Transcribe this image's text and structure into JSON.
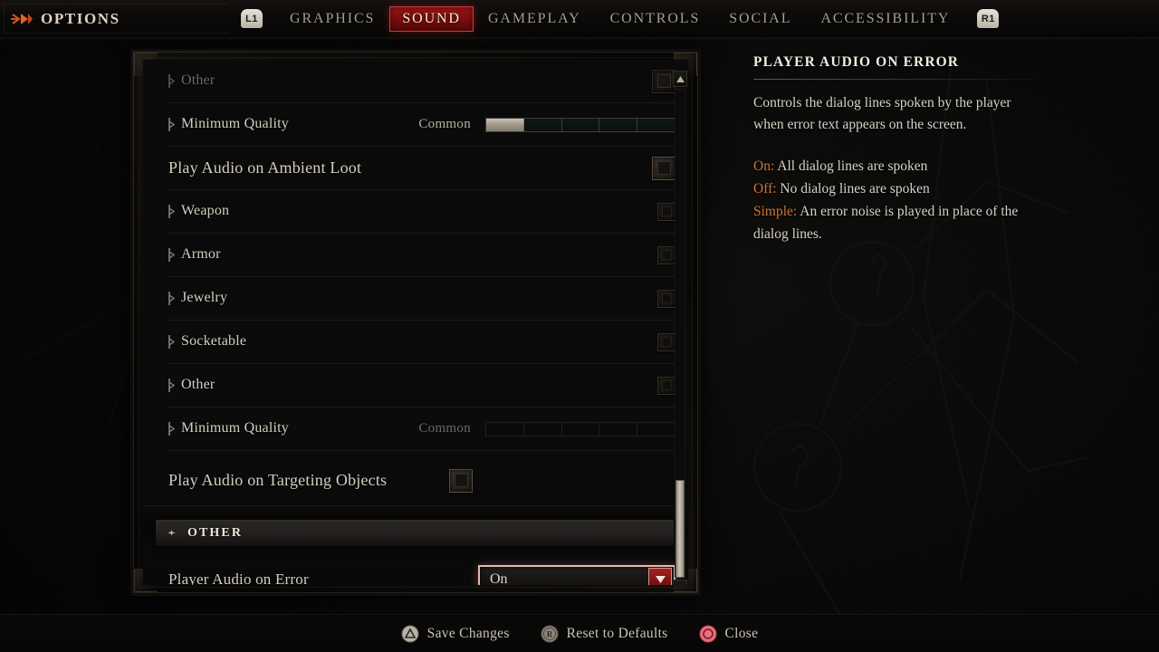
{
  "topbar": {
    "arrow_icon": "double-arrow-icon",
    "title": "OPTIONS",
    "left_bumper": "L1",
    "right_bumper": "R1",
    "tabs": [
      {
        "label": "GRAPHICS",
        "active": false
      },
      {
        "label": "SOUND",
        "active": true
      },
      {
        "label": "GAMEPLAY",
        "active": false
      },
      {
        "label": "CONTROLS",
        "active": false
      },
      {
        "label": "SOCIAL",
        "active": false
      },
      {
        "label": "ACCESSIBILITY",
        "active": false
      }
    ]
  },
  "settings_rows": [
    {
      "label": "Other",
      "type": "checkbox",
      "indent": true,
      "dim": true,
      "checked": false
    },
    {
      "label": "Minimum Quality",
      "type": "slider",
      "indent": true,
      "dim": false,
      "value": "Common",
      "segments": 5,
      "filled": 1
    },
    {
      "label": "Play Audio on Ambient Loot",
      "type": "checkbox",
      "indent": false,
      "dim": false,
      "checked": false
    },
    {
      "label": "Weapon",
      "type": "checkbox",
      "indent": true,
      "dim": false,
      "checked": false
    },
    {
      "label": "Armor",
      "type": "checkbox",
      "indent": true,
      "dim": false,
      "checked": false
    },
    {
      "label": "Jewelry",
      "type": "checkbox",
      "indent": true,
      "dim": false,
      "checked": false
    },
    {
      "label": "Socketable",
      "type": "checkbox",
      "indent": true,
      "dim": false,
      "checked": false
    },
    {
      "label": "Other",
      "type": "checkbox",
      "indent": true,
      "dim": false,
      "checked": false
    },
    {
      "label": "Minimum Quality",
      "type": "slider",
      "indent": true,
      "dim": true,
      "value": "Common",
      "segments": 5,
      "filled": 0
    },
    {
      "label": "Play Audio on Targeting Objects",
      "type": "checkbox",
      "indent": false,
      "dim": false,
      "checked": false
    }
  ],
  "other_section": {
    "ornament_icon": "diamond-ornament-icon",
    "title": "OTHER",
    "row": {
      "label": "Player Audio on Error",
      "dropdown_value": "On",
      "dropdown_arrow_icon": "chevron-down-icon"
    }
  },
  "scrollbar": {
    "up_icon": "arrow-up-icon",
    "down_icon": "arrow-down-icon"
  },
  "info_panel": {
    "title": "PLAYER AUDIO ON ERROR",
    "description": "Controls the dialog lines spoken by the player when error text appears on the screen.",
    "options": [
      {
        "key": "On:",
        "text": "All dialog lines are spoken"
      },
      {
        "key": "Off:",
        "text": "No dialog lines are spoken"
      },
      {
        "key": "Simple:",
        "text": "An error noise is played in place of the dialog lines."
      }
    ]
  },
  "actionbar": {
    "items": [
      {
        "glyph": "triangle-button-icon",
        "label": "Save Changes"
      },
      {
        "glyph": "r-button-icon",
        "label": "Reset to Defaults"
      },
      {
        "glyph": "circle-button-icon",
        "label": "Close"
      }
    ]
  },
  "colors": {
    "accent_red": "#a01515",
    "highlight_pink": "#e8b8ae",
    "keyword_orange": "#d2742d",
    "text_primary": "#d9d2c6",
    "close_pink": "#ef6e7e"
  }
}
